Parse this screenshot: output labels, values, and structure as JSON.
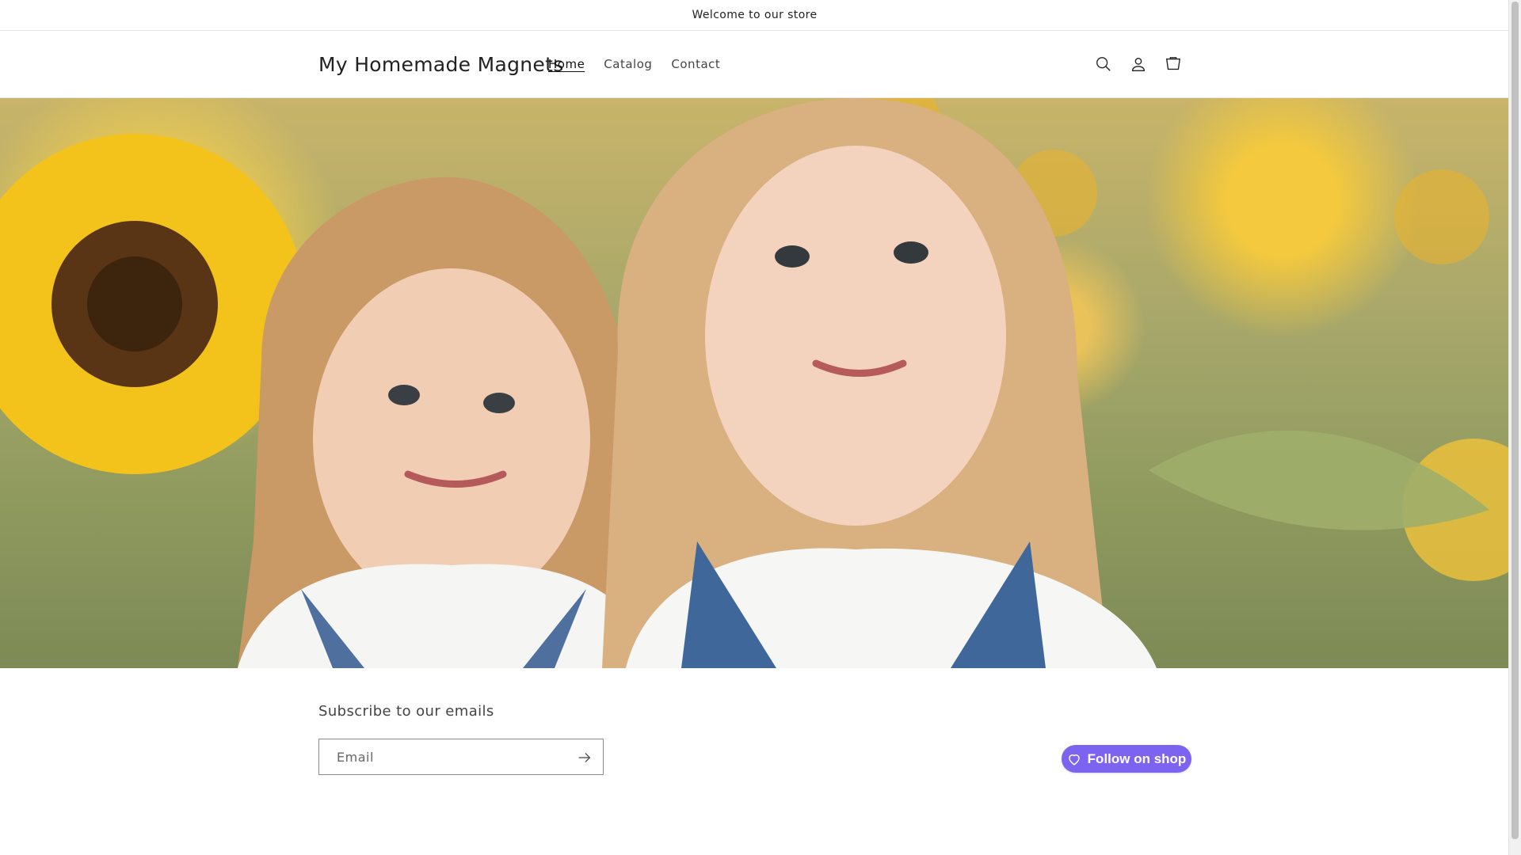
{
  "announcement": {
    "text": "Welcome to our store"
  },
  "header": {
    "logo": "My Homemade Magnets",
    "nav": [
      {
        "label": "Home",
        "active": true
      },
      {
        "label": "Catalog",
        "active": false
      },
      {
        "label": "Contact",
        "active": false
      }
    ],
    "icons": [
      "search-icon",
      "account-icon",
      "cart-icon"
    ]
  },
  "hero": {
    "image": "two-girls-in-sunflower-field"
  },
  "newsletter": {
    "title": "Subscribe to our emails",
    "email_placeholder": "Email"
  },
  "follow": {
    "label": "Follow on shop",
    "color": "#7d64f0"
  }
}
